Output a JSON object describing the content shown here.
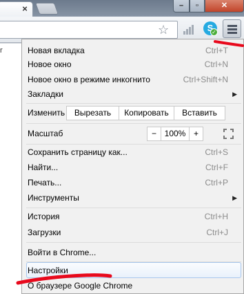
{
  "window": {
    "tab_close_glyph": "×",
    "controls": {
      "minimize": "–",
      "maximize": "▫",
      "close": "✕"
    }
  },
  "toolbar": {
    "bookmark_icon": "star-icon",
    "extension_icons": [
      "signal-icon",
      "skype-icon"
    ],
    "skype_glyph": "S",
    "skype_badge_glyph": "✓",
    "menu_button_icon": "wrench-menu-icon"
  },
  "page": {
    "edge_text": "r"
  },
  "menu": {
    "group1": [
      {
        "label": "Новая вкладка",
        "shortcut": "Ctrl+T"
      },
      {
        "label": "Новое окно",
        "shortcut": "Ctrl+N"
      },
      {
        "label": "Новое окно в режиме инкогнито",
        "shortcut": "Ctrl+Shift+N"
      },
      {
        "label": "Закладки",
        "shortcut": "",
        "arrow": "▶"
      }
    ],
    "edit": {
      "label": "Изменить",
      "cut": "Вырезать",
      "copy": "Копировать",
      "paste": "Вставить"
    },
    "zoom": {
      "label": "Масштаб",
      "minus": "−",
      "value": "100%",
      "plus": "+",
      "fullscreen_icon": "fullscreen-icon"
    },
    "group2": [
      {
        "label": "Сохранить страницу как...",
        "shortcut": "Ctrl+S"
      },
      {
        "label": "Найти...",
        "shortcut": "Ctrl+F"
      },
      {
        "label": "Печать...",
        "shortcut": "Ctrl+P"
      },
      {
        "label": "Инструменты",
        "shortcut": "",
        "arrow": "▶"
      }
    ],
    "group3": [
      {
        "label": "История",
        "shortcut": "Ctrl+H"
      },
      {
        "label": "Загрузки",
        "shortcut": "Ctrl+J"
      }
    ],
    "signin": {
      "label": "Войти в Chrome..."
    },
    "settings": {
      "label": "Настройки",
      "highlighted": true
    },
    "about": {
      "label": "О браузере Google Chrome"
    }
  },
  "annotations": {
    "marker_color": "#e8091c"
  }
}
